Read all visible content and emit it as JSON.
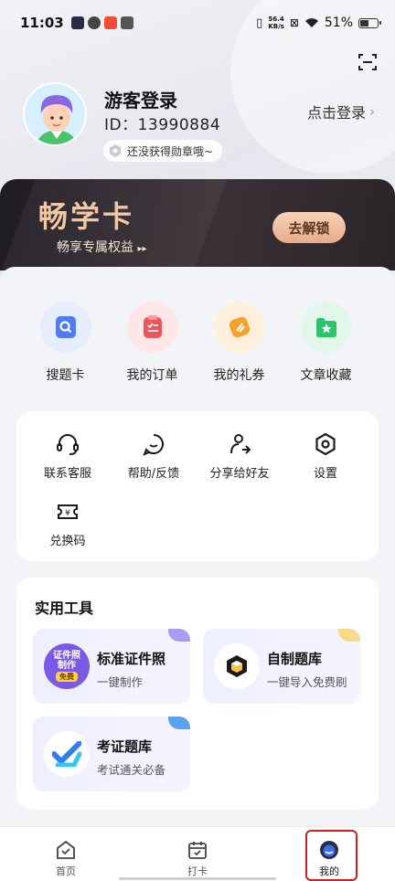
{
  "status_bar": {
    "time": "11:03",
    "speed_value": "56.4",
    "speed_unit": "KB/s",
    "battery": "51%",
    "battery_level": 0.51
  },
  "profile": {
    "name": "游客登录",
    "id": "ID：13990884",
    "login_label": "点击登录",
    "badge_text": "还没获得勋章哦~"
  },
  "vip": {
    "title": "畅学卡",
    "subtitle": "畅享专属权益",
    "button": "去解锁"
  },
  "quick_actions": [
    {
      "label": "搜题卡",
      "icon": "search-card-icon",
      "color": "#4d7cf5"
    },
    {
      "label": "我的订单",
      "icon": "order-icon",
      "color": "#f0545a"
    },
    {
      "label": "我的礼券",
      "icon": "coupon-icon",
      "color": "#f8a12a"
    },
    {
      "label": "文章收藏",
      "icon": "favorite-folder-icon",
      "color": "#2cc36b"
    }
  ],
  "services": [
    {
      "label": "联系客服",
      "icon": "headset-icon"
    },
    {
      "label": "帮助/反馈",
      "icon": "chat-bubble-icon"
    },
    {
      "label": "分享给好友",
      "icon": "share-icon"
    },
    {
      "label": "设置",
      "icon": "settings-icon"
    },
    {
      "label": "兑换码",
      "icon": "ticket-icon"
    }
  ],
  "tools": {
    "title": "实用工具",
    "items": [
      {
        "name": "标准证件照",
        "desc": "一键制作",
        "icon": "id-photo-icon",
        "icon_text_1": "证件照",
        "icon_text_2": "制作",
        "icon_tag": "免费",
        "corner_color": "#a89df2"
      },
      {
        "name": "自制题库",
        "desc": "一键导入免费刷",
        "icon": "cube-icon",
        "corner_color": "#f7d98a"
      },
      {
        "name": "考证题库",
        "desc": "考试通关必备",
        "icon": "checkmark-logo-icon",
        "corner_color": "#5aa3f0"
      }
    ]
  },
  "tab_bar": [
    {
      "label": "首页",
      "icon": "home-icon"
    },
    {
      "label": "打卡",
      "icon": "calendar-check-icon"
    },
    {
      "label": "我的",
      "icon": "profile-icon",
      "active": true
    }
  ]
}
